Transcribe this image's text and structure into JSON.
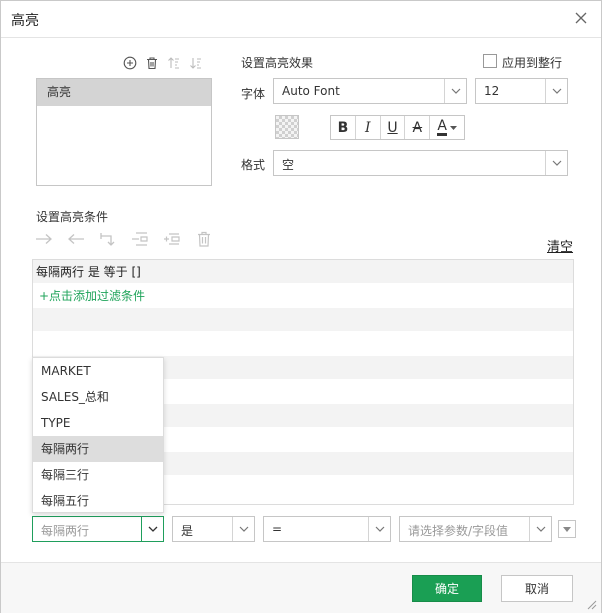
{
  "dialog": {
    "title": "高亮"
  },
  "rules_panel": {
    "items": [
      "高亮"
    ]
  },
  "effect": {
    "section_label": "设置高亮效果",
    "apply_row_label": "应用到整行",
    "font_label": "字体",
    "font_value": "Auto Font",
    "size_value": "12",
    "format_label": "格式",
    "format_value": "空",
    "bold": "B",
    "italic": "I",
    "underline": "U",
    "strike": "A",
    "color": "A"
  },
  "condition": {
    "section_label": "设置高亮条件",
    "clear_label": "清空",
    "rows": [
      {
        "text": "每隔两行 是 等于 []"
      },
      {
        "text": "+点击添加过滤条件"
      }
    ]
  },
  "field_dropdown": {
    "options": [
      "MARKET",
      "SALES_总和",
      "TYPE",
      "每隔两行",
      "每隔三行",
      "每隔五行"
    ],
    "hovered": "每隔两行"
  },
  "filter_bar": {
    "field_value": "每隔两行",
    "operator_value": "是",
    "compare_value": "=",
    "param_placeholder": "请选择参数/字段值"
  },
  "footer": {
    "ok_label": "确定",
    "cancel_label": "取消"
  },
  "colors": {
    "accent": "#1a9f54",
    "link_green": "#1fa35a",
    "selection": "#d4d4d4"
  }
}
